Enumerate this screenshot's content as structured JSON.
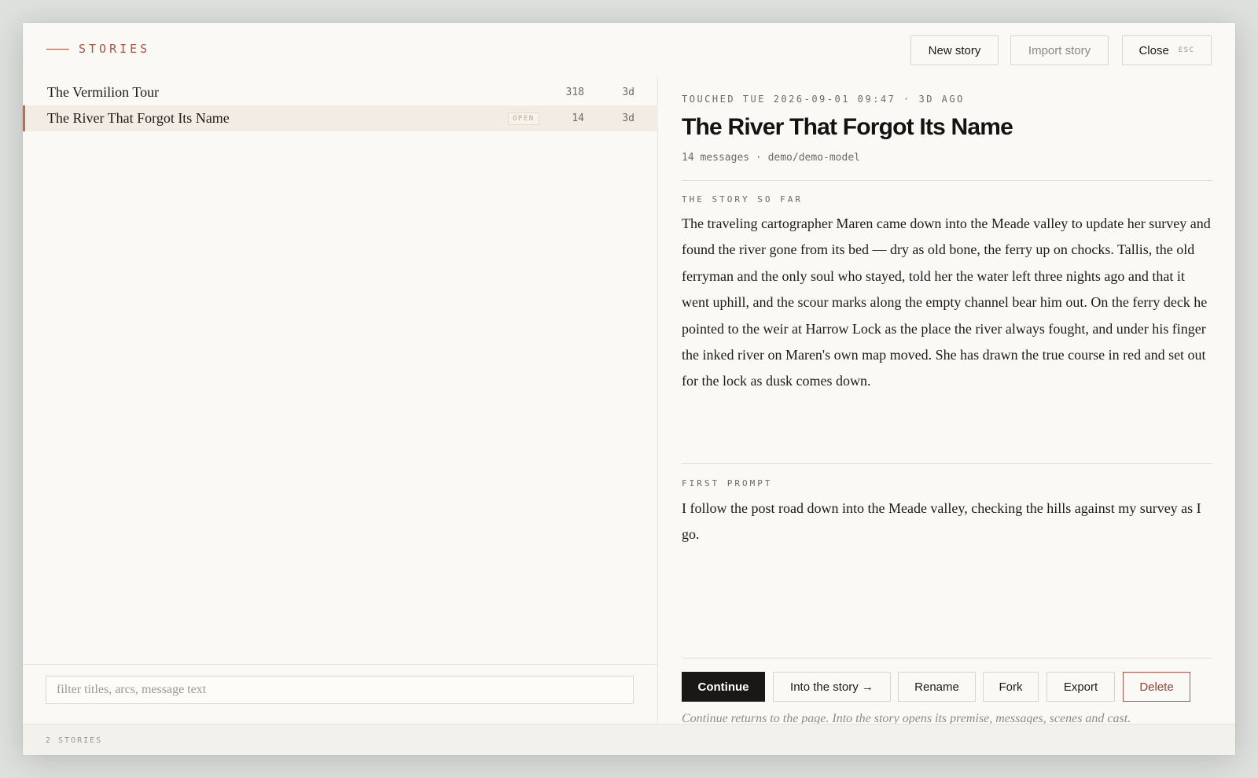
{
  "header": {
    "brand": "STORIES",
    "new_story": "New story",
    "import_story": "Import story",
    "close": "Close",
    "close_key": "ESC"
  },
  "stories": [
    {
      "title": "The Vermilion Tour",
      "count": "318",
      "age": "3d",
      "badge": ""
    },
    {
      "title": "The River That Forgot Its Name",
      "count": "14",
      "age": "3d",
      "badge": "OPEN"
    }
  ],
  "filter": {
    "placeholder": "filter titles, arcs, message text"
  },
  "footer": {
    "count": "2 STORIES"
  },
  "detail": {
    "touched": "TOUCHED TUE 2026-09-01 09:47 · 3D AGO",
    "title": "The River That Forgot Its Name",
    "meta": "14 messages · demo/demo-model",
    "summary_label": "THE STORY SO FAR",
    "summary": "The traveling cartographer Maren came down into the Meade valley to update her survey and found the river gone from its bed — dry as old bone, the ferry up on chocks. Tallis, the old ferryman and the only soul who stayed, told her the water left three nights ago and that it went uphill, and the scour marks along the empty channel bear him out. On the ferry deck he pointed to the weir at Harrow Lock as the place the river always fought, and under his finger the inked river on Maren's own map moved. She has drawn the true course in red and set out for the lock as dusk comes down.",
    "prompt_label": "FIRST PROMPT",
    "prompt": "I follow the post road down into the Meade valley, checking the hills against my survey as I go.",
    "hint": "Continue returns to the page. Into the story opens its premise, messages, scenes and cast."
  },
  "actions": {
    "continue": "Continue",
    "into": "Into the story →",
    "rename": "Rename",
    "fork": "Fork",
    "export": "Export",
    "delete": "Delete"
  },
  "colors": {
    "accent": "#a9553d",
    "selected_row": "#f3ece4",
    "delete": "#a23d30",
    "primary_button": "#1a1816"
  }
}
